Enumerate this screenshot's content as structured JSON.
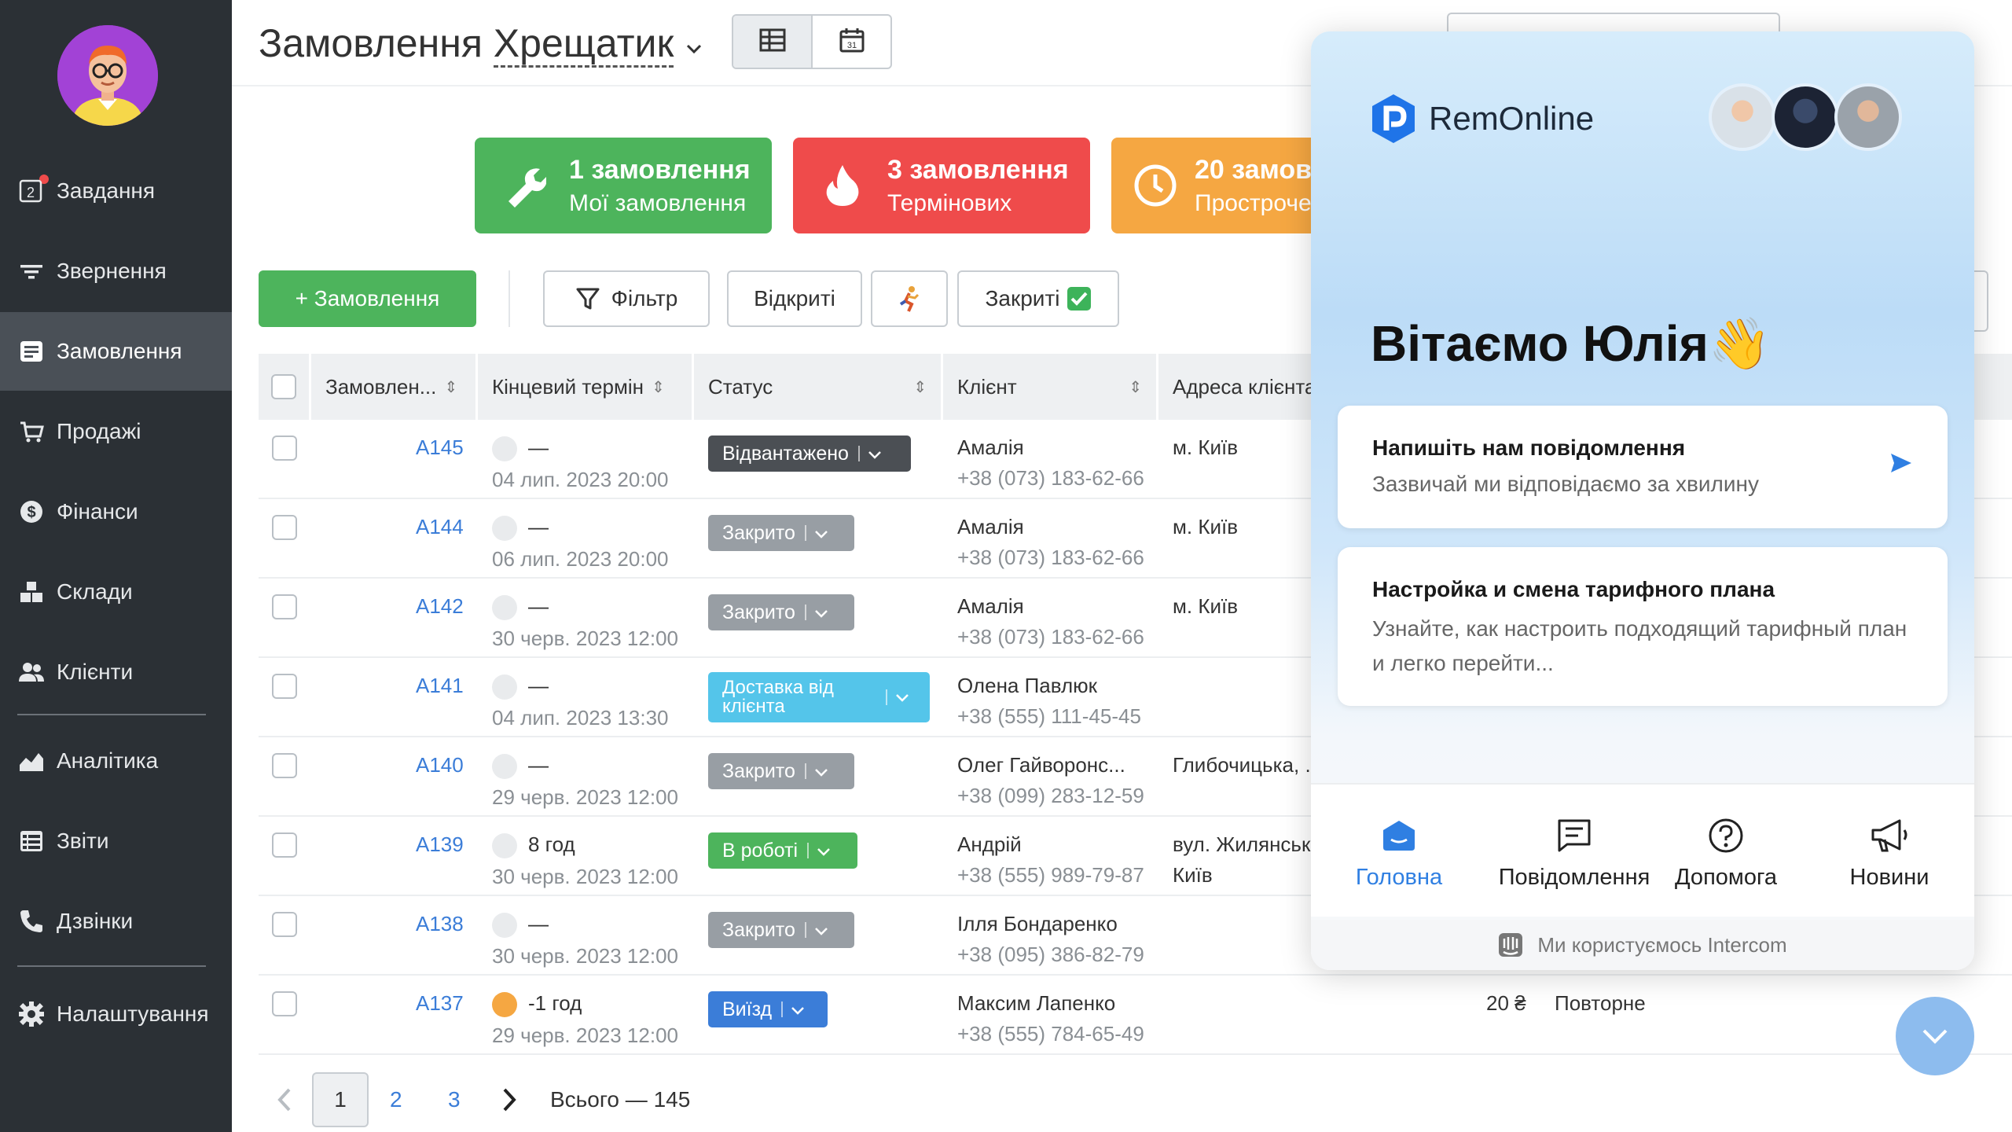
{
  "sidebar": {
    "items": [
      {
        "label": "Завдання",
        "icon": "tasks-icon",
        "badge": "2"
      },
      {
        "label": "Звернення",
        "icon": "filter-lines-icon"
      },
      {
        "label": "Замовлення",
        "icon": "orders-icon"
      },
      {
        "label": "Продажі",
        "icon": "cart-icon"
      },
      {
        "label": "Фінанси",
        "icon": "dollar-icon"
      },
      {
        "label": "Склади",
        "icon": "boxes-icon"
      },
      {
        "label": "Клієнти",
        "icon": "users-icon"
      },
      {
        "label": "Аналітика",
        "icon": "chart-area-icon"
      },
      {
        "label": "Звіти",
        "icon": "reports-icon"
      },
      {
        "label": "Дзвінки",
        "icon": "phone-icon"
      },
      {
        "label": "Налаштування",
        "icon": "gear-icon"
      }
    ],
    "active_index": 2
  },
  "header": {
    "title": "Замовлення",
    "location": "Хрещатик"
  },
  "stats": [
    {
      "count": "1 замовлення",
      "label": "Мої замовлення",
      "color": "#4db45c"
    },
    {
      "count": "3 замовлення",
      "label": "Термінових",
      "color": "#ef4b4b"
    },
    {
      "count": "20 замов",
      "label": "Простроче",
      "color": "#f5a742"
    }
  ],
  "toolbar": {
    "new_order": "+ Замовлення",
    "filter": "Фільтр",
    "open": "Відкриті",
    "closed": "Закриті"
  },
  "table": {
    "headers": [
      "Замовлен...",
      "Кінцевий термін",
      "Статус",
      "Клієнт",
      "Адреса клієнта"
    ],
    "rows": [
      {
        "id": "A145",
        "due": "—",
        "date": "04 лип. 2023 20:00",
        "status": "Відвантажено",
        "client": "Амалія",
        "phone": "+38 (073) 183-62-66",
        "address": "м. Київ",
        "address2": ""
      },
      {
        "id": "A144",
        "due": "—",
        "date": "06 лип. 2023 20:00",
        "status": "Закрито",
        "client": "Амалія",
        "phone": "+38 (073) 183-62-66",
        "address": "м. Київ",
        "address2": ""
      },
      {
        "id": "A142",
        "due": "—",
        "date": "30 черв. 2023 12:00",
        "status": "Закрито",
        "client": "Амалія",
        "phone": "+38 (073) 183-62-66",
        "address": "м. Київ",
        "address2": ""
      },
      {
        "id": "A141",
        "due": "—",
        "date": "04 лип. 2023 13:30",
        "status": "Доставка від клієнта",
        "client": "Олена Павлюк",
        "phone": "+38 (555) 111-45-45",
        "address": "",
        "address2": ""
      },
      {
        "id": "A140",
        "due": "—",
        "date": "29 черв. 2023 12:00",
        "status": "Закрито",
        "client": "Олег Гайворонс...",
        "phone": "+38 (099) 283-12-59",
        "address": "Глибочицька, ...",
        "address2": ""
      },
      {
        "id": "A139",
        "due": "8 год",
        "date": "30 черв. 2023 12:00",
        "status": "В роботі",
        "client": "Андрій",
        "phone": "+38 (555) 989-79-87",
        "address": "вул. Жилянськ",
        "address2": "Київ"
      },
      {
        "id": "A138",
        "due": "—",
        "date": "30 черв. 2023 12:00",
        "status": "Закрито",
        "client": "Ілля Бондаренко",
        "phone": "+38 (095) 386-82-79",
        "address": "",
        "address2": ""
      },
      {
        "id": "A137",
        "due": "-1 год",
        "date": "29 черв. 2023 12:00",
        "status": "Виїзд",
        "client": "Максим Лапенко",
        "phone": "+38 (555) 784-65-49",
        "address": "",
        "address2": "",
        "amount": "20 ₴",
        "type": "Повторне"
      }
    ]
  },
  "pagination": {
    "pages": [
      "1",
      "2",
      "3"
    ],
    "current": "1",
    "total": "Всього — 145"
  },
  "intercom": {
    "brand": "RemOnline",
    "greeting": "Вітаємо Юлія👋",
    "cards": [
      {
        "title": "Напишіть нам повідомлення",
        "subtitle": "Зазвичай ми відповідаємо за хвилину"
      },
      {
        "title": "Настройка и смена тарифного плана",
        "subtitle": "Узнайте, как настроить подходящий тарифный план и легко перейти..."
      }
    ],
    "nav": [
      {
        "label": "Головна",
        "icon": "home-icon"
      },
      {
        "label": "Повідомлення",
        "icon": "messages-icon"
      },
      {
        "label": "Допомога",
        "icon": "help-icon"
      },
      {
        "label": "Новини",
        "icon": "megaphone-icon"
      }
    ],
    "powered": "Ми користуємось Intercom"
  }
}
